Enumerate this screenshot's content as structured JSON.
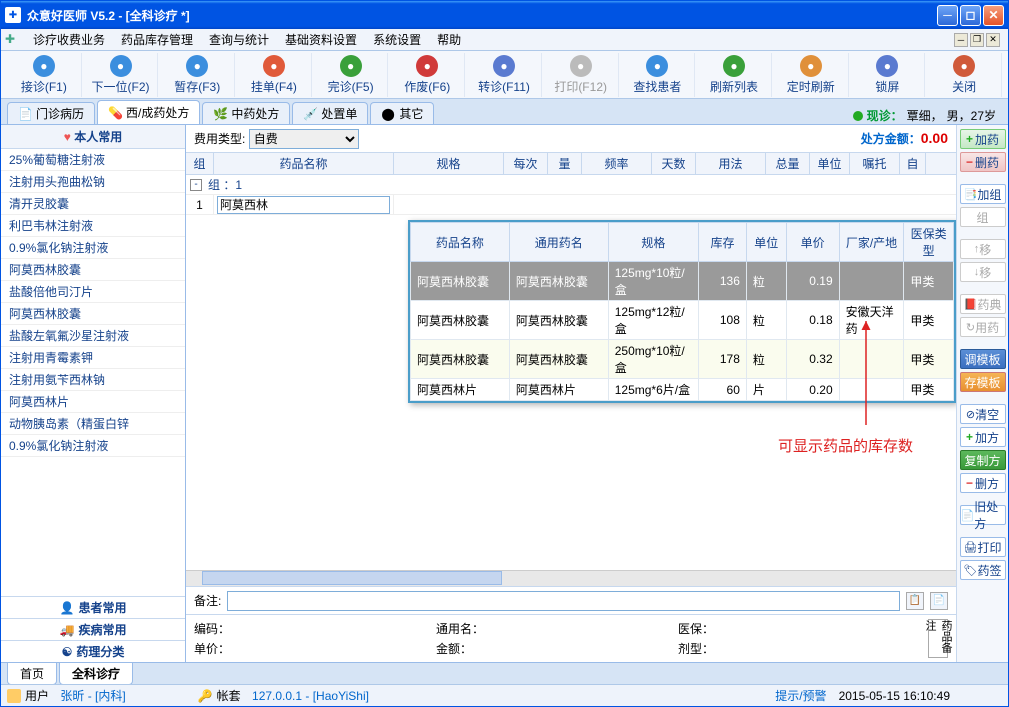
{
  "window": {
    "title": "众意好医师 V5.2 - [全科诊疗 *]"
  },
  "menus": [
    "诊疗收费业务",
    "药品库存管理",
    "查询与统计",
    "基础资料设置",
    "系统设置",
    "帮助"
  ],
  "toolbar": [
    {
      "label": "接诊(F1)",
      "color": "#3b8ede"
    },
    {
      "label": "下一位(F2)",
      "color": "#3b8ede"
    },
    {
      "label": "暂存(F3)",
      "color": "#3b8ede"
    },
    {
      "label": "挂单(F4)",
      "color": "#e05a3a"
    },
    {
      "label": "完诊(F5)",
      "color": "#3aa03a"
    },
    {
      "label": "作废(F6)",
      "color": "#d03a3a"
    },
    {
      "label": "转诊(F11)",
      "color": "#5a7ad0"
    },
    {
      "label": "打印(F12)",
      "color": "#bbb",
      "dis": true
    },
    {
      "label": "查找患者",
      "color": "#3b8ede"
    },
    {
      "label": "刷新列表",
      "color": "#3aa03a"
    },
    {
      "label": "定时刷新",
      "color": "#e0903a"
    },
    {
      "label": "锁屏",
      "color": "#5a7ad0"
    },
    {
      "label": "关闭",
      "color": "#d05a3a"
    }
  ],
  "tabs": {
    "items": [
      "门诊病历",
      "西/成药处方",
      "中药处方",
      "处置单",
      "其它"
    ],
    "active": 1
  },
  "patient": {
    "prefix": "现诊：",
    "name": "覃细，",
    "info": "男，27岁"
  },
  "left": {
    "header": "本人常用",
    "items": [
      "25%葡萄糖注射液",
      "注射用头孢曲松钠",
      "清开灵胶囊",
      "利巴韦林注射液",
      "0.9%氯化钠注射液",
      "阿莫西林胶囊",
      "盐酸倍他司汀片",
      "阿莫西林胶囊",
      "盐酸左氧氟沙星注射液",
      "注射用青霉素钾",
      "注射用氨苄西林钠",
      "阿莫西林片",
      "动物胰岛素（精蛋白锌",
      "0.9%氯化钠注射液"
    ],
    "footers": [
      "患者常用",
      "疾病常用",
      "药理分类"
    ]
  },
  "costType": {
    "label": "费用类型:",
    "value": "自费"
  },
  "amount": {
    "label": "处方金额：",
    "value": "0.00"
  },
  "gridCols": [
    "组",
    "药品名称",
    "规格",
    "每次",
    "量",
    "频率",
    "天数",
    "用法",
    "总量",
    "单位",
    "嘱托",
    "自"
  ],
  "groupRow": "组 ：1",
  "inputRow": {
    "num": "1",
    "value": "阿莫西林"
  },
  "popup": {
    "cols": [
      "药品名称",
      "通用药名",
      "规格",
      "库存",
      "单位",
      "单价",
      "厂家/产地",
      "医保类型"
    ],
    "rows": [
      {
        "sel": true,
        "c": [
          "阿莫西林胶囊",
          "阿莫西林胶囊",
          "125mg*10粒/盒",
          "136",
          "粒",
          "0.19",
          "",
          "甲类"
        ]
      },
      {
        "c": [
          "阿莫西林胶囊",
          "阿莫西林胶囊",
          "125mg*12粒/盒",
          "108",
          "粒",
          "0.18",
          "安徽天洋药",
          "甲类"
        ]
      },
      {
        "alt": true,
        "c": [
          "阿莫西林胶囊",
          "阿莫西林胶囊",
          "250mg*10粒/盒",
          "178",
          "粒",
          "0.32",
          "",
          "甲类"
        ]
      },
      {
        "c": [
          "阿莫西林片",
          "阿莫西林片",
          "125mg*6片/盒",
          "60",
          "片",
          "0.20",
          "",
          "甲类"
        ]
      }
    ]
  },
  "annotation": "可显示药品的库存数",
  "rightBtns": {
    "addDrug": "加药",
    "delDrug": "删药",
    "addGrp": "加组",
    "grp": "组",
    "move": "移",
    "move2": "移",
    "dict": "药典",
    "useDrug": "用药",
    "tplLoad": "调模板",
    "tplSave": "存模板",
    "clear": "清空",
    "addRx": "加方",
    "copyRx": "复制方",
    "delRx": "删方",
    "oldRx": "旧处方",
    "print": "打印",
    "sign": "药签"
  },
  "memo": {
    "label": "备注:"
  },
  "info": {
    "code": "编码：",
    "generic": "通用名：",
    "ins": "医保：",
    "price": "单价：",
    "amt": "金额：",
    "form": "剂型：",
    "box": "药品备注"
  },
  "bottomTabs": [
    "首页",
    "全科诊疗"
  ],
  "status": {
    "user": "用户",
    "userName": "张昕 - [内科]",
    "acct": "帐套",
    "acctVal": "127.0.0.1 - [HaoYiShi]",
    "alert": "提示/预警",
    "time": "2015-05-15 16:10:49"
  }
}
